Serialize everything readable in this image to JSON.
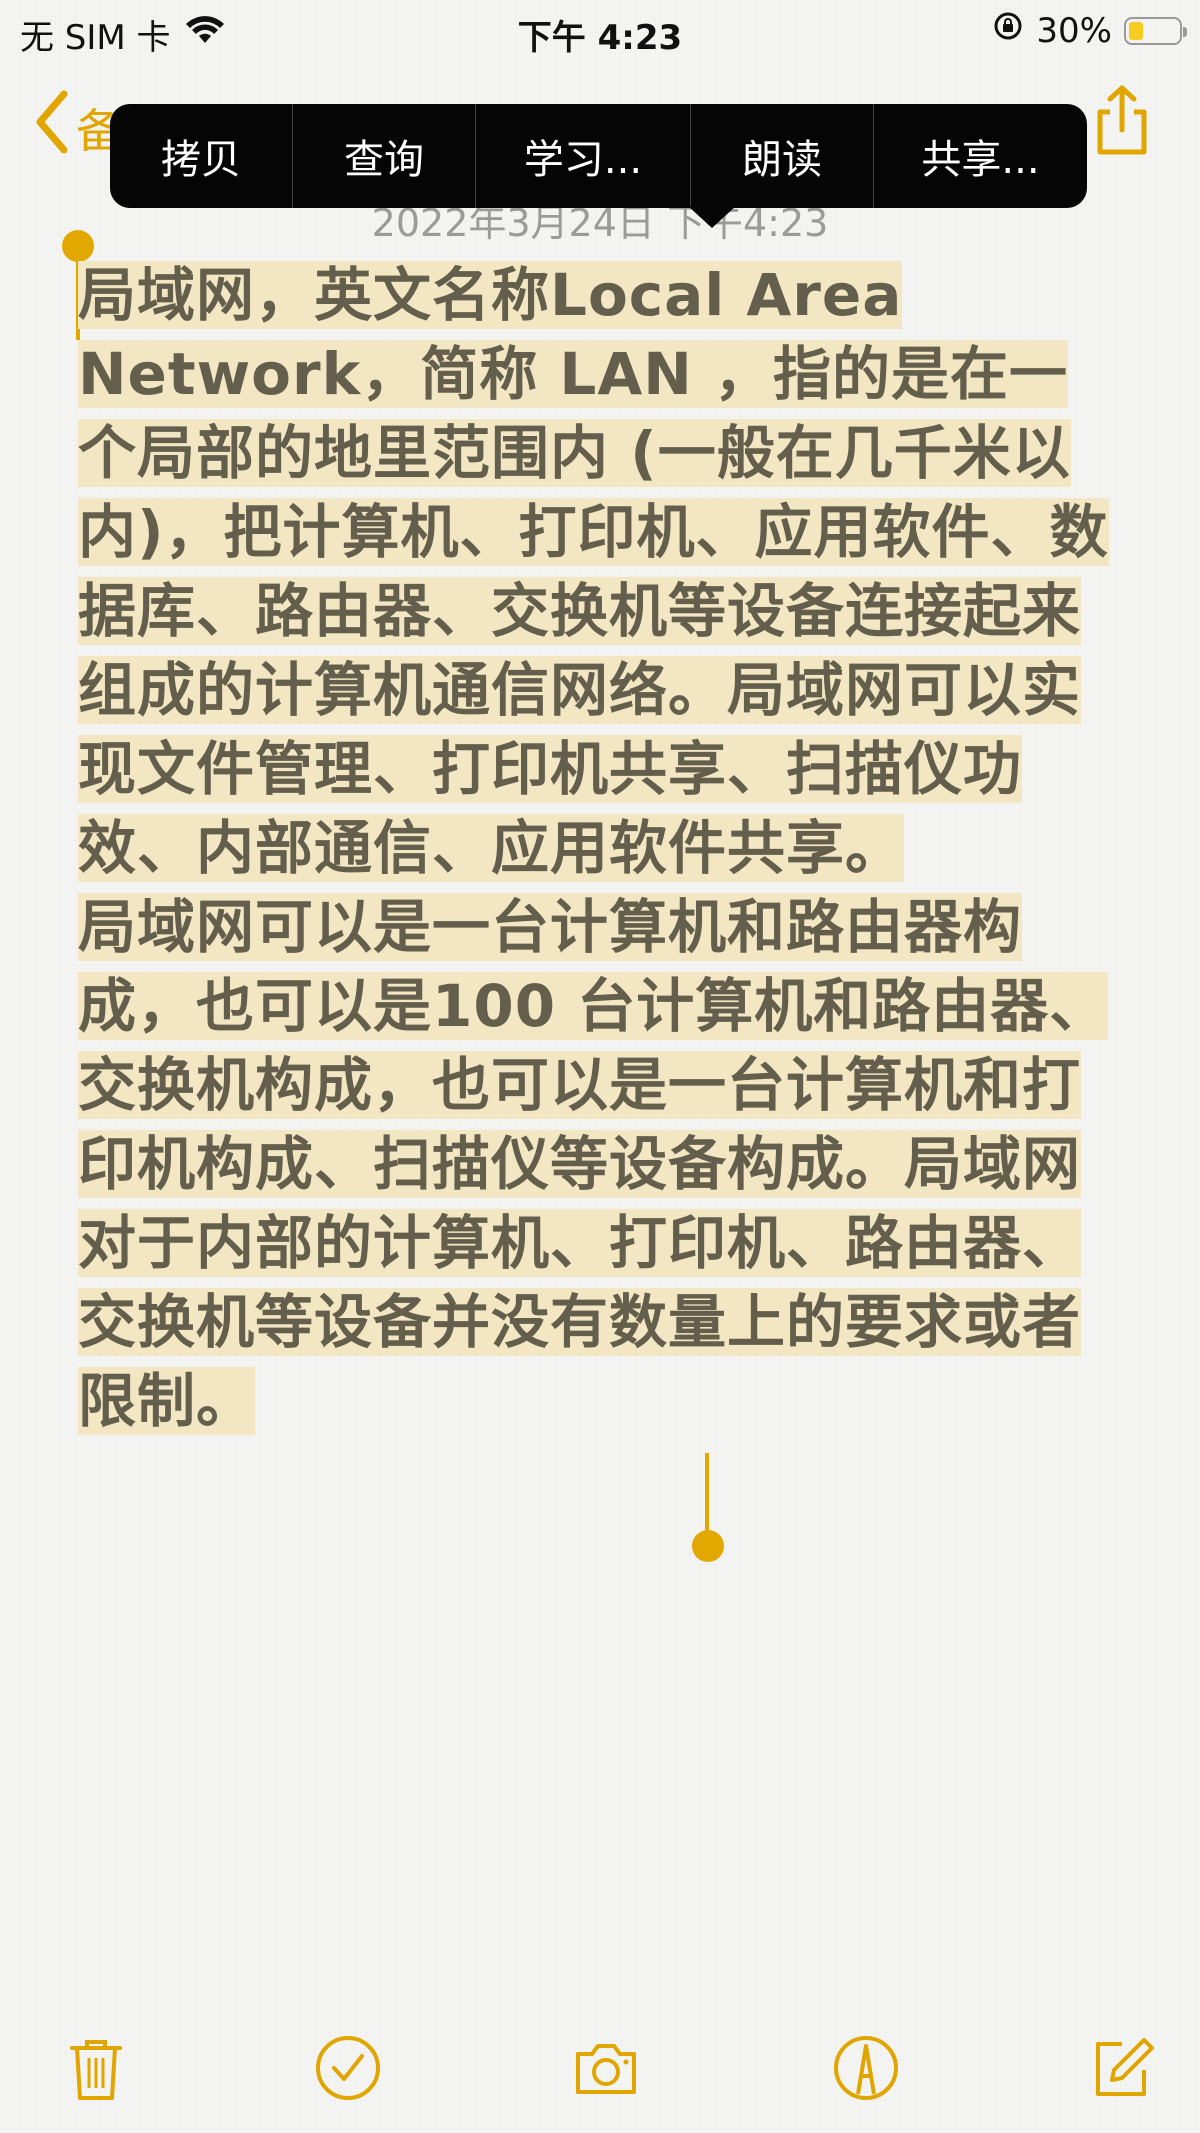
{
  "status_bar": {
    "carrier": "无 SIM 卡",
    "time": "下午 4:23",
    "battery_percent": "30%",
    "battery_level": 0.3,
    "wifi_icon": "wifi-icon",
    "lock_icon": "orientation-lock-icon"
  },
  "nav": {
    "back_label": "备忘录",
    "back_icon": "chevron-left-icon",
    "share_icon": "share-icon"
  },
  "note": {
    "date": "2022年3月24日 下午4:23",
    "paragraphs": [
      "局域网，英文名称Local Area Network，简称 LAN ，指的是在一个局部的地里范围内 (一般在几千米以内)，把计算机、打印机、应用软件、数据库、路由器、交换机等设备连接起来组成的计算机通信网络。局域网可以实现文件管理、打印机共享、扫描仪功效、内部通信、应用软件共享。",
      "局域网可以是一台计算机和路由器构成，也可以是100 台计算机和路由器、交换机构成，也可以是一台计算机和打印机构成、扫描仪等设备构成。局域网对于内部的计算机、打印机、路由器、交换机等设备并没有数量上的要求或者限制。"
    ]
  },
  "context_menu": {
    "items": [
      "拷贝",
      "查询",
      "学习...",
      "朗读",
      "共享..."
    ]
  },
  "toolbar": {
    "icons": [
      "trash-icon",
      "checklist-icon",
      "camera-icon",
      "markup-icon",
      "compose-icon"
    ]
  },
  "colors": {
    "accent": "#e3a800",
    "selection": "#f3e6c3",
    "text": "#645f4c",
    "menu_bg": "#050505"
  }
}
